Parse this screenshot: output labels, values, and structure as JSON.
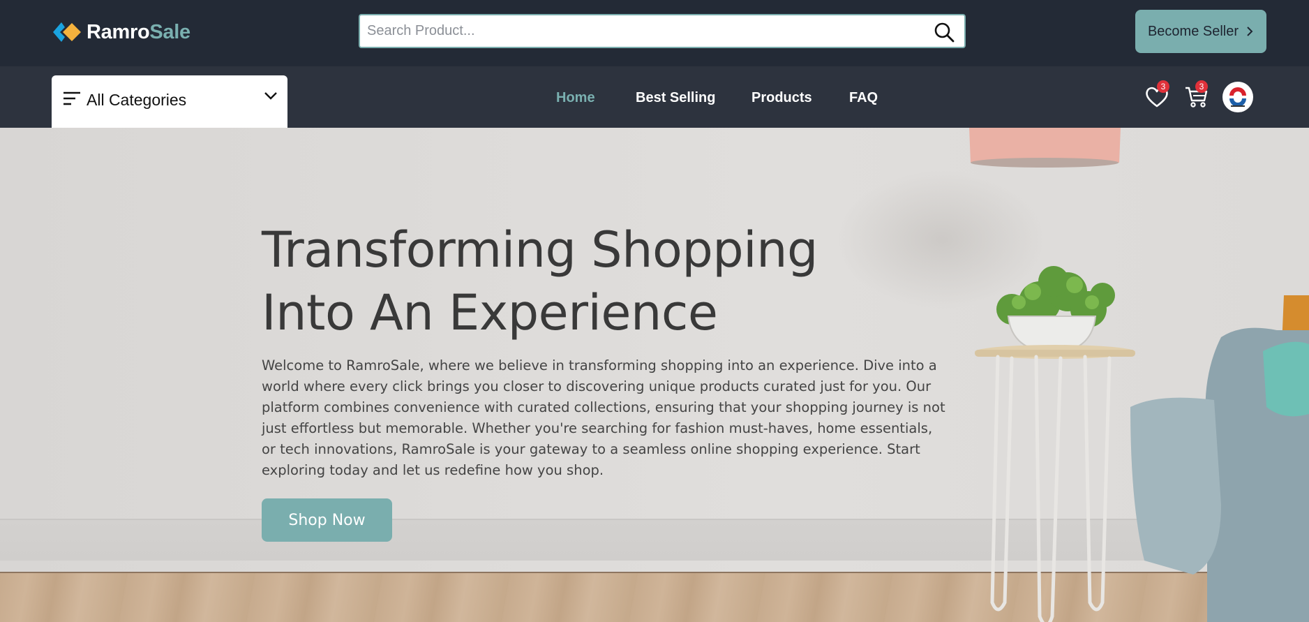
{
  "brand": {
    "name_part1": "Ramro",
    "name_part2": "Sale"
  },
  "search": {
    "placeholder": "Search Product..."
  },
  "header": {
    "seller_button_label": "Become Seller"
  },
  "categories": {
    "label": "All Categories"
  },
  "nav": {
    "items": [
      {
        "label": "Home",
        "active": true
      },
      {
        "label": "Best Selling",
        "active": false
      },
      {
        "label": "Products",
        "active": false
      },
      {
        "label": "FAQ",
        "active": false
      }
    ]
  },
  "wishlist": {
    "count": "3"
  },
  "cart": {
    "count": "3"
  },
  "hero": {
    "title_line1": "Transforming Shopping",
    "title_line2": "Into An Experience",
    "text_lines": [
      "Welcome to RamroSale, where we believe in transforming shopping into an experience. Dive into a",
      "world where every click brings you closer to discovering unique products curated just for you. Our",
      "platform combines convenience with curated collections, ensuring that your shopping journey is not",
      "just effortless but memorable. Whether you're searching for fashion must-haves, home essentials,",
      "or tech innovations, RamroSale is your gateway to a seamless online shopping experience. Start",
      "exploring today and let us redefine how you shop."
    ],
    "button_label": "Shop Now"
  },
  "colors": {
    "header_bg": "#232a36",
    "nav_bg": "#2d333e",
    "accent": "#7aaeae",
    "badge": "#e0313a"
  },
  "icons": [
    "logo-mark-icon",
    "search-icon",
    "chevron-right-icon",
    "menu-icon",
    "chevron-down-icon",
    "heart-icon",
    "cart-icon"
  ]
}
